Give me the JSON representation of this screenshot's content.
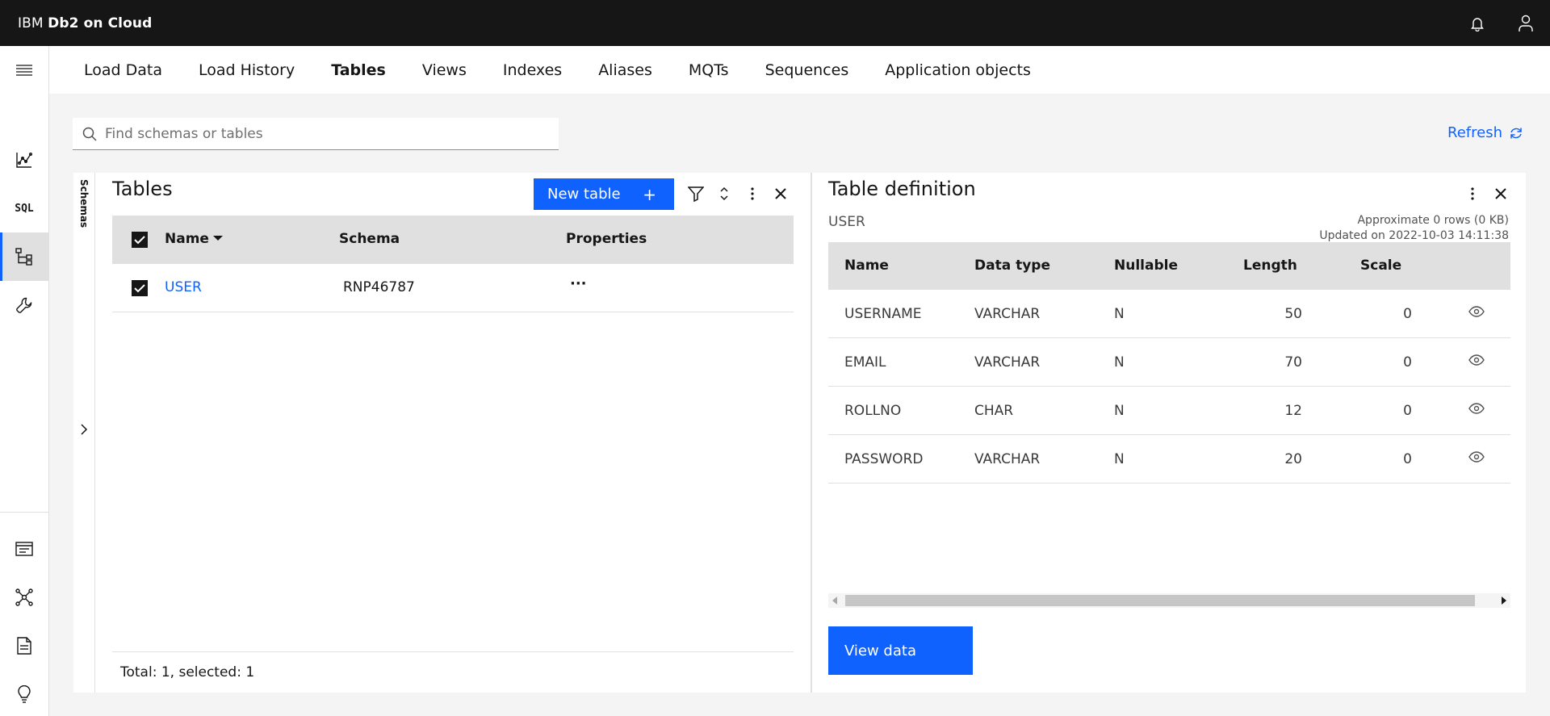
{
  "header": {
    "brand_prefix": "IBM ",
    "brand_name": "Db2 on Cloud"
  },
  "tabs": [
    {
      "label": "Load Data",
      "active": false
    },
    {
      "label": "Load History",
      "active": false
    },
    {
      "label": "Tables",
      "active": true
    },
    {
      "label": "Views",
      "active": false
    },
    {
      "label": "Indexes",
      "active": false
    },
    {
      "label": "Aliases",
      "active": false
    },
    {
      "label": "MQTs",
      "active": false
    },
    {
      "label": "Sequences",
      "active": false
    },
    {
      "label": "Application objects",
      "active": false
    }
  ],
  "rail": {
    "sql_label": "SQL"
  },
  "search": {
    "placeholder": "Find schemas or tables",
    "value": ""
  },
  "refresh_label": "Refresh",
  "tables_panel": {
    "schemas_label": "Schemas",
    "title": "Tables",
    "new_table_label": "New table",
    "new_table_icon": "+",
    "columns": [
      "Name",
      "Schema",
      "Properties"
    ],
    "rows": [
      {
        "name": "USER",
        "schema": "RNP46787",
        "properties": "···",
        "selected": true
      }
    ],
    "footer": "Total: 1, selected: 1"
  },
  "definition_panel": {
    "title": "Table definition",
    "table_name": "USER",
    "meta_rows": "Approximate 0 rows (0 KB)",
    "meta_updated": "Updated on 2022-10-03 14:11:38",
    "columns": [
      "Name",
      "Data type",
      "Nullable",
      "Length",
      "Scale"
    ],
    "rows": [
      {
        "name": "USERNAME",
        "type": "VARCHAR",
        "nullable": "N",
        "length": "50",
        "scale": "0"
      },
      {
        "name": "EMAIL",
        "type": "VARCHAR",
        "nullable": "N",
        "length": "70",
        "scale": "0"
      },
      {
        "name": "ROLLNO",
        "type": "CHAR",
        "nullable": "N",
        "length": "12",
        "scale": "0"
      },
      {
        "name": "PASSWORD",
        "type": "VARCHAR",
        "nullable": "N",
        "length": "20",
        "scale": "0"
      }
    ],
    "view_data_label": "View data"
  },
  "colors": {
    "accent": "#0f62fe",
    "header_bg": "#161616",
    "page_bg": "#f4f4f4"
  }
}
